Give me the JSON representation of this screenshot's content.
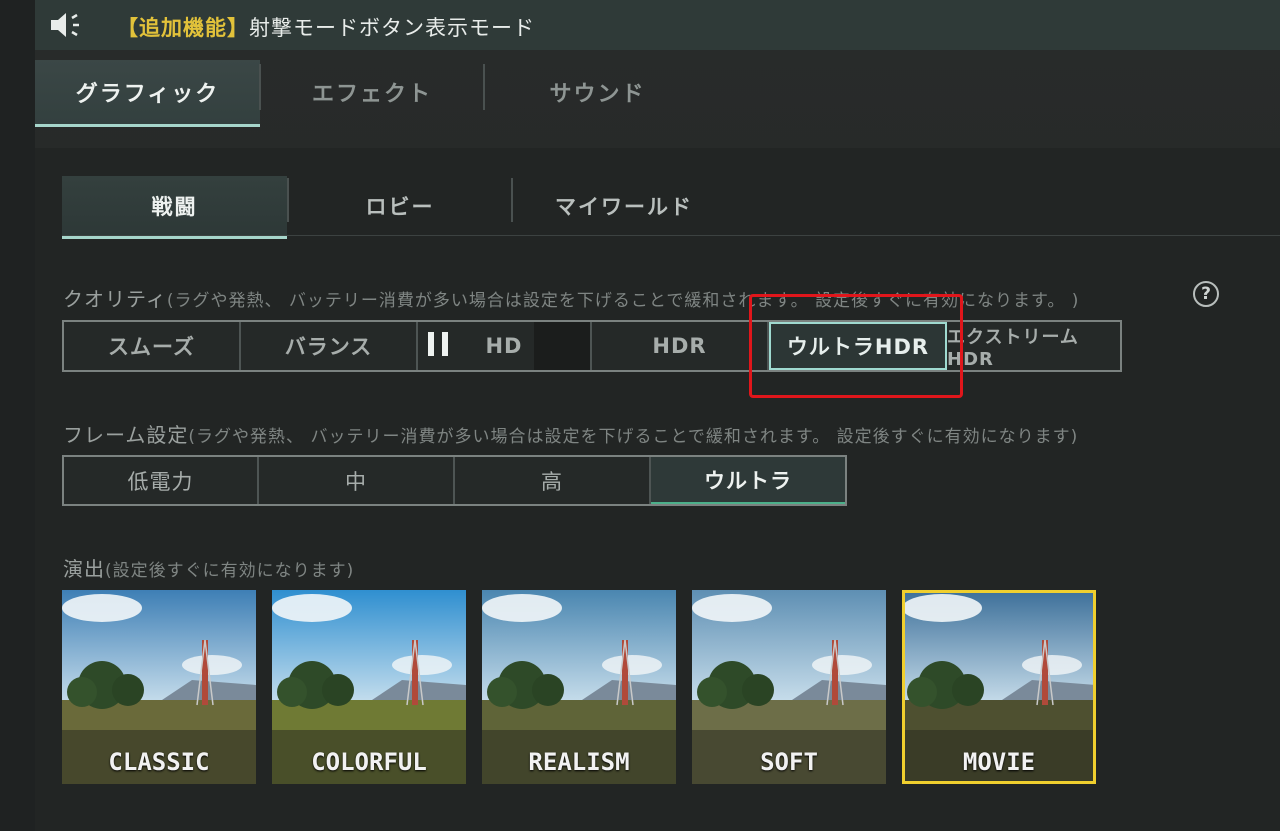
{
  "announcement": {
    "tag": "【追加機能】",
    "message": "射撃モードボタン表示モード"
  },
  "main_tabs": [
    {
      "label": "グラフィック",
      "active": true
    },
    {
      "label": "エフェクト",
      "active": false
    },
    {
      "label": "サウンド",
      "active": false
    }
  ],
  "sub_tabs": [
    {
      "label": "戦闘",
      "active": true
    },
    {
      "label": "ロビー",
      "active": false
    },
    {
      "label": "マイワールド",
      "active": false
    }
  ],
  "quality": {
    "title": "クオリティ",
    "note": "(ラグや発熱、 バッテリー消費が多い場合は設定を下げることで緩和されます。 設定後すぐに有効になります。 )",
    "options": [
      "スムーズ",
      "バランス",
      "HD",
      "HDR",
      "ウルトラHDR",
      "エクストリームHDR"
    ],
    "selected": "ウルトラHDR"
  },
  "frame": {
    "title": "フレーム設定",
    "note": "(ラグや発熱、 バッテリー消費が多い場合は設定を下げることで緩和されます。 設定後すぐに有効になります)",
    "options": [
      "低電力",
      "中",
      "高",
      "ウルトラ"
    ],
    "selected": "ウルトラ"
  },
  "style": {
    "title": "演出",
    "note": "(設定後すぐに有効になります)",
    "options": [
      "CLASSIC",
      "COLORFUL",
      "REALISM",
      "SOFT",
      "MOVIE"
    ],
    "selected": "MOVIE"
  },
  "colors": {
    "accent": "#a6d6cb",
    "tag": "#e2c23a",
    "selected_style": "#f0cf2e",
    "highlight": "#e0161b"
  },
  "icons": {
    "speaker": "speaker-icon",
    "help": "help-icon",
    "pause": "pause-icon"
  },
  "help_glyph": "?"
}
